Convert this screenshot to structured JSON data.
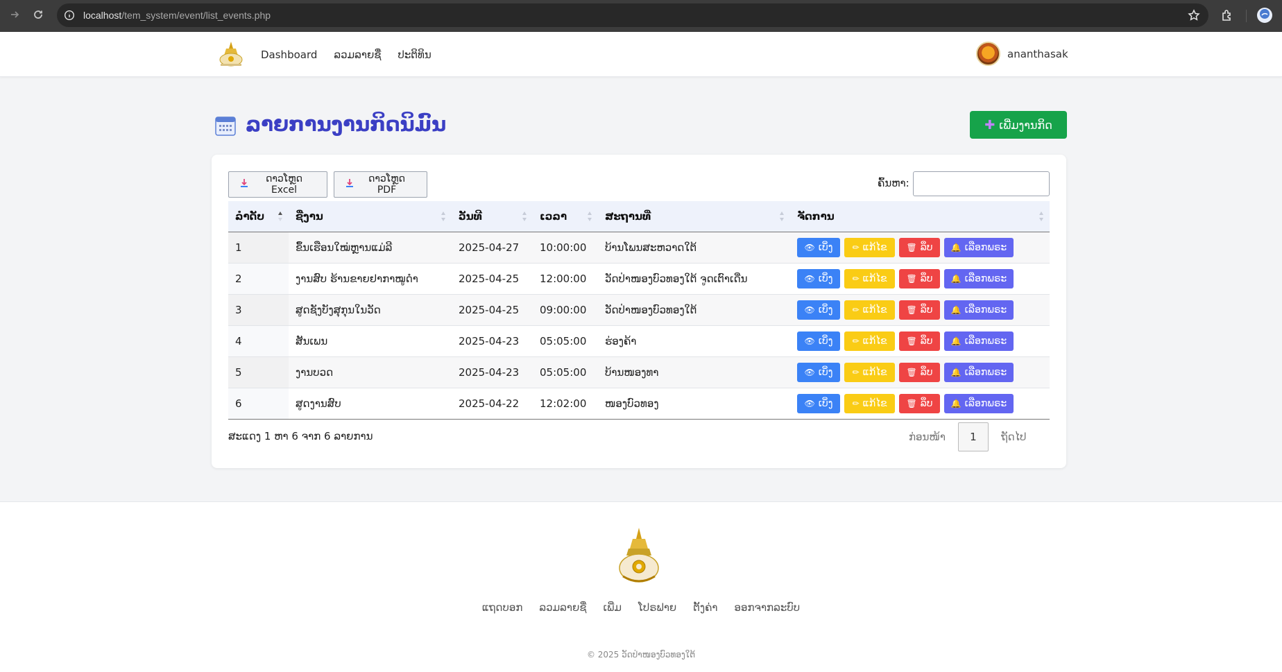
{
  "browser": {
    "url_host": "localhost",
    "url_path": "/tem_system/event/list_events.php"
  },
  "nav": {
    "links": [
      "Dashboard",
      "ລວມລາຍຊື່",
      "ປະຕິທິນ"
    ],
    "username": "ananthasak"
  },
  "page": {
    "title": "ລາຍການງານກິດນິມົນ",
    "add_button": "ເພີ່ມງານກິດ"
  },
  "toolbar": {
    "export_excel": "ດາວໂຫຼດ Excel",
    "export_pdf": "ດາວໂຫຼດ PDF",
    "search_label": "ຄົ້ນຫາ:",
    "search_value": ""
  },
  "table": {
    "columns": [
      "ລໍາດັບ",
      "ຊື່ງານ",
      "ວັນທີ",
      "ເວລາ",
      "ສະຖານທີ່",
      "ຈັດການ"
    ],
    "actions": {
      "view": "ເບິ່ງ",
      "edit": "ແກ້ໄຂ",
      "delete": "ລຶບ",
      "monk": "ເລືອກພຣະ"
    },
    "rows": [
      {
        "no": "1",
        "name": "ຂຶ້ນເຮືອນໃໝ່ຫຼານແມ່ລີ",
        "date": "2025-04-27",
        "time": "10:00:00",
        "place": "ບ້ານໂພນສະຫວາດໃຕ້"
      },
      {
        "no": "2",
        "name": "ງານສົບ ຮ້ານຂາຍຢາກາໝູດໍາ",
        "date": "2025-04-25",
        "time": "12:00:00",
        "place": "ວັດປ່າໜອງບົວທອງໃຕ້ ຈູດເຕົາເດີ່ນ"
      },
      {
        "no": "3",
        "name": "ສູດຊັງບັງສຸກຸນໃນວັດ",
        "date": "2025-04-25",
        "time": "09:00:00",
        "place": "ວັດປ່າໜອງບົວທອງໃຕ້"
      },
      {
        "no": "4",
        "name": "ສັນເພນ",
        "date": "2025-04-23",
        "time": "05:05:00",
        "place": "ຮ່ອງຄ້າ"
      },
      {
        "no": "5",
        "name": "ງານບວດ",
        "date": "2025-04-23",
        "time": "05:05:00",
        "place": "ບ້ານໜອງທາ"
      },
      {
        "no": "6",
        "name": "ສູດງານສົບ",
        "date": "2025-04-22",
        "time": "12:02:00",
        "place": "ໜອງບົວທອງ"
      }
    ]
  },
  "summary": "ສະແດງ 1 ຫາ 6 ຈາກ 6 ລາຍການ",
  "pagination": {
    "prev": "ກ່ອນໜ້າ",
    "current": "1",
    "next": "ຖັດໄປ"
  },
  "footer": {
    "links": [
      "ແຖດບອກ",
      "ລວມລາຍຊື່",
      "ເພີ່ມ",
      "ໂປຣຟາຍ",
      "ຕັ້ງຄ່າ",
      "ອອກຈາກລະບົບ"
    ],
    "copyright": "© 2025 ວັດປ່າໜອງບົວທອງໃຕ້"
  },
  "colors": {
    "title": "#3b3fc4",
    "add_button": "#16a34a",
    "view": "#3b82f6",
    "edit": "#facc15",
    "delete": "#ef4444",
    "monk": "#6366f1"
  }
}
